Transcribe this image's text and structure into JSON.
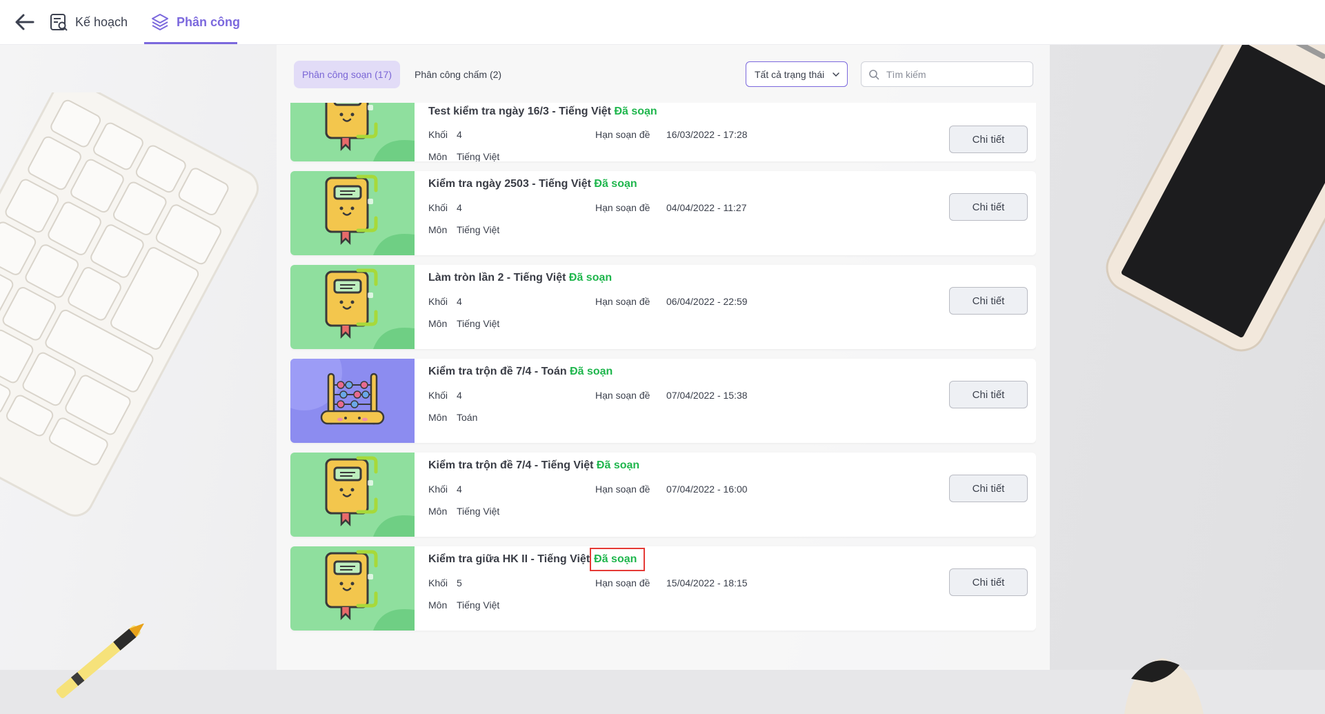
{
  "nav": {
    "back_icon": "arrow-left-icon",
    "tabs": [
      {
        "label": "Kế hoạch",
        "icon": "plan-list-icon",
        "active": false
      },
      {
        "label": "Phân công",
        "icon": "layers-icon",
        "active": true
      }
    ]
  },
  "toolbar": {
    "tabs": [
      {
        "label": "Phân công soạn (17)",
        "active": true
      },
      {
        "label": "Phân công chấm (2)",
        "active": false
      }
    ],
    "status_filter": "Tất cả trạng thái",
    "search_placeholder": "Tìm kiếm"
  },
  "labels": {
    "grade": "Khối",
    "subject": "Môn",
    "deadline": "Hạn soạn đề",
    "detail_button": "Chi tiết"
  },
  "colors": {
    "accent": "#7b68dd",
    "status_done": "#1fb64d",
    "highlight_box": "#e53935"
  },
  "items": [
    {
      "title": "Test kiểm tra ngày 16/3 - Tiếng Việt",
      "status": "Đã soạn",
      "grade": "4",
      "deadline": "16/03/2022 - 17:28",
      "subject": "Tiếng Việt",
      "thumb": "book-icon"
    },
    {
      "title": "Kiểm tra ngày 2503 - Tiếng Việt",
      "status": "Đã soạn",
      "grade": "4",
      "deadline": "04/04/2022 - 11:27",
      "subject": "Tiếng Việt",
      "thumb": "book-icon"
    },
    {
      "title": "Làm tròn lần 2 - Tiếng Việt",
      "status": "Đã soạn",
      "grade": "4",
      "deadline": "06/04/2022 - 22:59",
      "subject": "Tiếng Việt",
      "thumb": "book-icon"
    },
    {
      "title": "Kiểm tra trộn đề 7/4 - Toán",
      "status": "Đã soạn",
      "grade": "4",
      "deadline": "07/04/2022 - 15:38",
      "subject": "Toán",
      "thumb": "abacus-icon"
    },
    {
      "title": "Kiểm tra trộn đề 7/4 - Tiếng Việt",
      "status": "Đã soạn",
      "grade": "4",
      "deadline": "07/04/2022 - 16:00",
      "subject": "Tiếng Việt",
      "thumb": "book-icon"
    },
    {
      "title": "Kiểm tra giữa HK II - Tiếng Việt",
      "status": "Đã soạn",
      "grade": "5",
      "deadline": "15/04/2022 - 18:15",
      "subject": "Tiếng Việt",
      "thumb": "book-icon",
      "highlighted": true
    }
  ]
}
